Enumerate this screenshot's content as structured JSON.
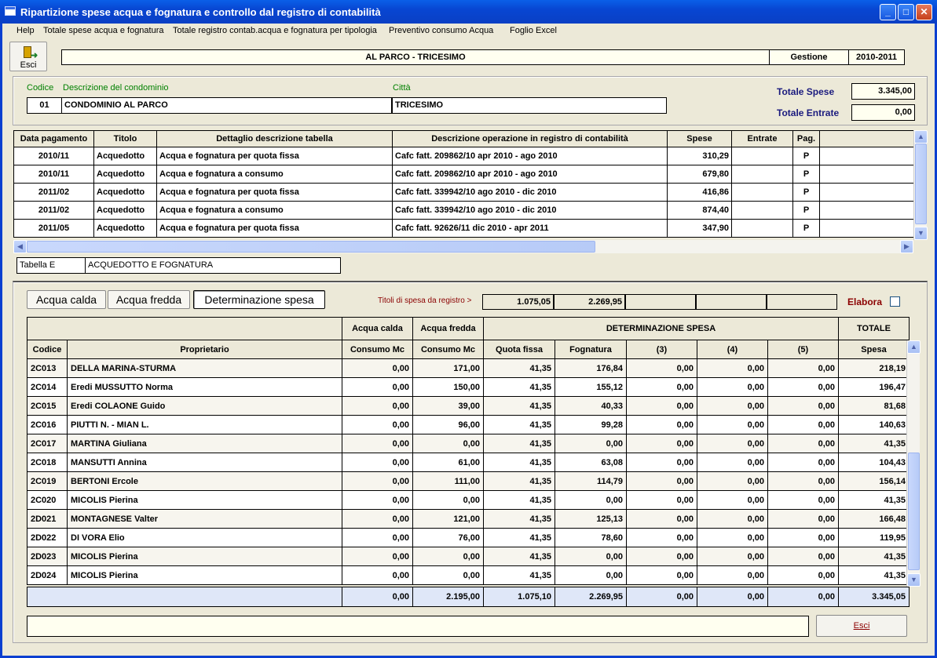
{
  "window": {
    "title": "Ripartizione spese acqua e fognatura e controllo dal registro di contabilità"
  },
  "menu": [
    "Help",
    "Totale spese acqua e fognatura",
    "Totale registro contab.acqua e fognatura per tipologia",
    "Preventivo consumo Acqua",
    "Foglio Excel"
  ],
  "toolbar": {
    "exit_label": "Esci"
  },
  "header": {
    "condo_name": "AL PARCO - TRICESIMO",
    "gestione_label": "Gestione",
    "gestione_value": "2010-2011"
  },
  "condo": {
    "codice_label": "Codice",
    "descr_label": "Descrizione del condominio",
    "citta_label": "Città",
    "codice": "01",
    "descrizione": "CONDOMINIO AL PARCO",
    "citta": "TRICESIMO",
    "totale_spese_label": "Totale Spese",
    "totale_spese": "3.345,00",
    "totale_entrate_label": "Totale Entrate",
    "totale_entrate": "0,00"
  },
  "registro": {
    "headers": [
      "Data pagamento",
      "Titolo",
      "Dettaglio descrizione tabella",
      "Descrizione operazione in registro di contabilità",
      "Spese",
      "Entrate",
      "Pag."
    ],
    "rows": [
      [
        "2010/11",
        "Acquedotto",
        "Acqua e fognatura per quota fissa",
        "Cafc fatt. 209862/10 apr 2010 - ago 2010",
        "310,29",
        "",
        "P"
      ],
      [
        "2010/11",
        "Acquedotto",
        "Acqua e fognatura a consumo",
        "Cafc fatt. 209862/10 apr 2010 - ago 2010",
        "679,80",
        "",
        "P"
      ],
      [
        "2011/02",
        "Acquedotto",
        "Acqua e fognatura per quota fissa",
        "Cafc fatt. 339942/10 ago 2010 - dic 2010",
        "416,86",
        "",
        "P"
      ],
      [
        "2011/02",
        "Acquedotto",
        "Acqua e fognatura a consumo",
        "Cafc fatt. 339942/10 ago 2010 - dic 2010",
        "874,40",
        "",
        "P"
      ],
      [
        "2011/05",
        "Acquedotto",
        "Acqua e fognatura per quota fissa",
        "Cafc fatt. 92626/11 dic 2010 - apr 2011",
        "347,90",
        "",
        "P"
      ]
    ]
  },
  "tabella": {
    "code": "Tabella E",
    "name": "ACQUEDOTTO E FOGNATURA"
  },
  "tabs": [
    "Acqua calda",
    "Acqua fredda",
    "Determinazione spesa"
  ],
  "titoli": {
    "label": "Titoli di spesa da registro >",
    "values": [
      "1.075,05",
      "2.269,95",
      "",
      "",
      ""
    ],
    "elabora_label": "Elabora"
  },
  "grid": {
    "top_headers": {
      "acqua_calda": "Acqua calda",
      "acqua_fredda": "Acqua fredda",
      "determinazione": "DETERMINAZIONE SPESA",
      "totale": "TOTALE"
    },
    "sub_headers": [
      "Codice",
      "Proprietario",
      "Consumo Mc",
      "Consumo Mc",
      "Quota fissa",
      "Fognatura",
      "(3)",
      "(4)",
      "(5)",
      "Spesa"
    ],
    "rows": [
      [
        "2C013",
        "DELLA MARINA-STURMA",
        "0,00",
        "171,00",
        "41,35",
        "176,84",
        "0,00",
        "0,00",
        "0,00",
        "218,19"
      ],
      [
        "2C014",
        "Eredi MUSSUTTO Norma",
        "0,00",
        "150,00",
        "41,35",
        "155,12",
        "0,00",
        "0,00",
        "0,00",
        "196,47"
      ],
      [
        "2C015",
        "Eredi COLAONE Guido",
        "0,00",
        "39,00",
        "41,35",
        "40,33",
        "0,00",
        "0,00",
        "0,00",
        "81,68"
      ],
      [
        "2C016",
        "PIUTTI N. - MIAN L.",
        "0,00",
        "96,00",
        "41,35",
        "99,28",
        "0,00",
        "0,00",
        "0,00",
        "140,63"
      ],
      [
        "2C017",
        "MARTINA Giuliana",
        "0,00",
        "0,00",
        "41,35",
        "0,00",
        "0,00",
        "0,00",
        "0,00",
        "41,35"
      ],
      [
        "2C018",
        "MANSUTTI Annina",
        "0,00",
        "61,00",
        "41,35",
        "63,08",
        "0,00",
        "0,00",
        "0,00",
        "104,43"
      ],
      [
        "2C019",
        "BERTONI Ercole",
        "0,00",
        "111,00",
        "41,35",
        "114,79",
        "0,00",
        "0,00",
        "0,00",
        "156,14"
      ],
      [
        "2C020",
        "MICOLIS Pierina",
        "0,00",
        "0,00",
        "41,35",
        "0,00",
        "0,00",
        "0,00",
        "0,00",
        "41,35"
      ],
      [
        "2D021",
        "MONTAGNESE Valter",
        "0,00",
        "121,00",
        "41,35",
        "125,13",
        "0,00",
        "0,00",
        "0,00",
        "166,48"
      ],
      [
        "2D022",
        "DI VORA Elio",
        "0,00",
        "76,00",
        "41,35",
        "78,60",
        "0,00",
        "0,00",
        "0,00",
        "119,95"
      ],
      [
        "2D023",
        "MICOLIS Pierina",
        "0,00",
        "0,00",
        "41,35",
        "0,00",
        "0,00",
        "0,00",
        "0,00",
        "41,35"
      ],
      [
        "2D024",
        "MICOLIS Pierina",
        "0,00",
        "0,00",
        "41,35",
        "0,00",
        "0,00",
        "0,00",
        "0,00",
        "41,35"
      ]
    ],
    "totals": [
      "0,00",
      "2.195,00",
      "1.075,10",
      "2.269,95",
      "0,00",
      "0,00",
      "0,00",
      "3.345,05"
    ]
  },
  "footer": {
    "esci_label": "Esci"
  }
}
